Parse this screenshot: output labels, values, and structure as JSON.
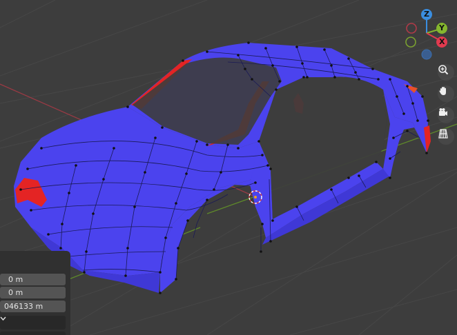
{
  "gizmo": {
    "axis_z_label": "Z",
    "axis_y_label": "Y",
    "axis_x_label": "X",
    "color_x": "#e23a4f",
    "color_y": "#85b72e",
    "color_z": "#3a8ee0"
  },
  "nav_tools": [
    {
      "name": "zoom",
      "icon": "zoom-in-icon"
    },
    {
      "name": "pan",
      "icon": "hand-icon"
    },
    {
      "name": "camera",
      "icon": "camera-icon"
    },
    {
      "name": "perspective",
      "icon": "grid-icon"
    }
  ],
  "redo_panel": {
    "field_1_value": "0 m",
    "field_2_value": "0 m",
    "field_3_value": "046133 m"
  },
  "mesh_colors": {
    "body": "#4b43ee",
    "backface": "#e42424",
    "background": "#3d3d3d"
  }
}
